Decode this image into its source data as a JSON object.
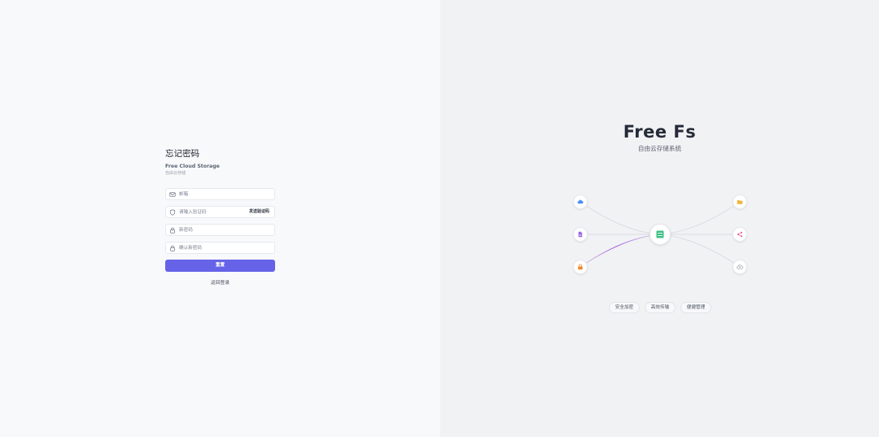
{
  "reset_form": {
    "title": "忘记密码",
    "subtitle": "Free Cloud Storage",
    "subtitle_cn": "自由云存储",
    "email": {
      "placeholder": "邮箱",
      "value": ""
    },
    "code": {
      "placeholder": "请输入验证码",
      "value": "",
      "send_label": "发送验证码"
    },
    "new_password": {
      "placeholder": "新密码",
      "value": ""
    },
    "confirm_password": {
      "placeholder": "确认新密码",
      "value": ""
    },
    "reset_label": "重置",
    "back_label": "返回登录"
  },
  "brand": {
    "title": "Free Fs",
    "subtitle": "自由云存储系统"
  },
  "network": {
    "hub_icon": "server-icon",
    "nodes": [
      {
        "icon": "cloud-icon",
        "color": "#4d8ff2"
      },
      {
        "icon": "file-icon",
        "color": "#9a63e0"
      },
      {
        "icon": "lock-icon",
        "color": "#f08a2b"
      },
      {
        "icon": "folder-icon",
        "color": "#f0b43a"
      },
      {
        "icon": "share-icon",
        "color": "#e04a8c"
      },
      {
        "icon": "upload-icon",
        "color": "#8a909b"
      }
    ],
    "hub_color": "#3dbf84"
  },
  "features": [
    "安全加密",
    "高效传输",
    "便捷管理"
  ],
  "colors": {
    "accent": "#6663e8",
    "left_bg": "#f8f9fb",
    "right_bg": "#f1f2f4"
  }
}
